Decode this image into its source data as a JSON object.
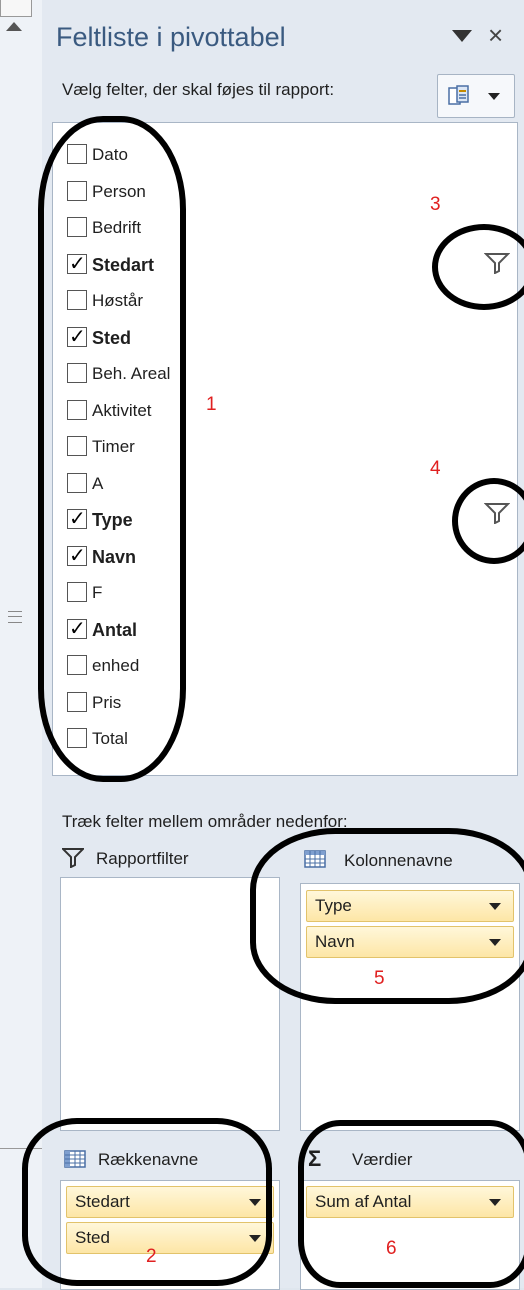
{
  "panel": {
    "title": "Feltliste i pivottabel",
    "subtitle": "Vælg felter, der skal føjes til rapport:"
  },
  "fields": [
    {
      "label": "Dato",
      "checked": false
    },
    {
      "label": "Person",
      "checked": false
    },
    {
      "label": "Bedrift",
      "checked": false
    },
    {
      "label": "Stedart",
      "checked": true
    },
    {
      "label": "Høstår",
      "checked": false
    },
    {
      "label": "Sted",
      "checked": true
    },
    {
      "label": "Beh. Areal",
      "checked": false
    },
    {
      "label": "Aktivitet",
      "checked": false
    },
    {
      "label": "Timer",
      "checked": false
    },
    {
      "label": "A",
      "checked": false
    },
    {
      "label": "Type",
      "checked": true
    },
    {
      "label": "Navn",
      "checked": true
    },
    {
      "label": "F",
      "checked": false
    },
    {
      "label": "Antal",
      "checked": true
    },
    {
      "label": "enhed",
      "checked": false
    },
    {
      "label": "Pris",
      "checked": false
    },
    {
      "label": "Total",
      "checked": false
    }
  ],
  "areas": {
    "drag_label": "Træk felter mellem områder nedenfor:",
    "report_filter": {
      "title": "Rapportfilter",
      "items": []
    },
    "column_labels": {
      "title": "Kolonnenavne",
      "items": [
        "Type",
        "Navn"
      ]
    },
    "row_labels": {
      "title": "Rækkenavne",
      "items": [
        "Stedart",
        "Sted"
      ]
    },
    "values": {
      "title": "Værdier",
      "sigma": "Σ",
      "items": [
        "Sum af Antal"
      ]
    }
  },
  "annotations": [
    "1",
    "2",
    "3",
    "4",
    "5",
    "6"
  ],
  "colors": {
    "title": "#3a5a80",
    "annotation": "#e02020",
    "pill_fill": "#fde6a6",
    "panel_bg": "#e3e9f1"
  },
  "icons": [
    "scroll-up-arrow-icon",
    "dropdown-arrow-icon",
    "close-icon",
    "field-layout-icon",
    "filter-funnel-icon",
    "table-grid-icon",
    "sigma-icon"
  ]
}
